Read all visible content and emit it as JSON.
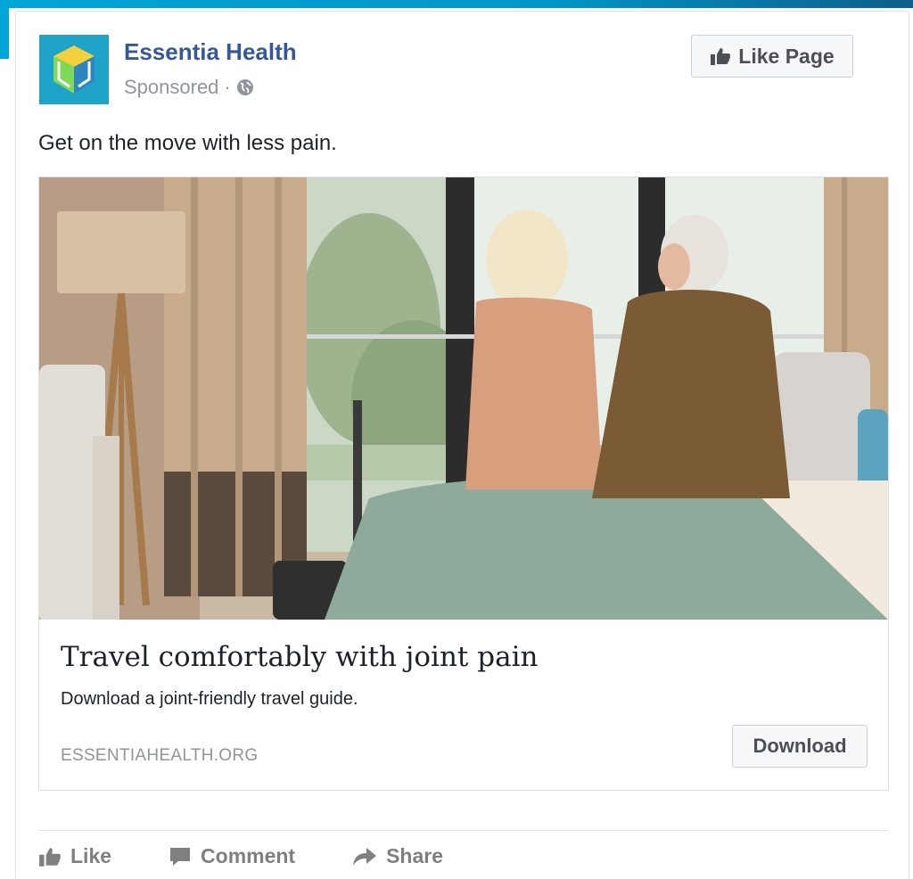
{
  "post": {
    "page_name": "Essentia Health",
    "sponsored_label": "Sponsored",
    "separator": "·",
    "privacy_icon": "globe-icon",
    "like_page_label": "Like Page",
    "text": "Get on the move with less pain."
  },
  "link": {
    "title": "Travel comfortably with joint pain",
    "description": "Download a joint-friendly travel guide.",
    "domain": "ESSENTIAHEALTH.ORG",
    "cta_label": "Download"
  },
  "actions": {
    "like": "Like",
    "comment": "Comment",
    "share": "Share"
  },
  "colors": {
    "brand_blue": "#365899",
    "header_accent": "#00a6d6",
    "muted_text": "#90949c",
    "action_gray": "#7f7f7f"
  }
}
